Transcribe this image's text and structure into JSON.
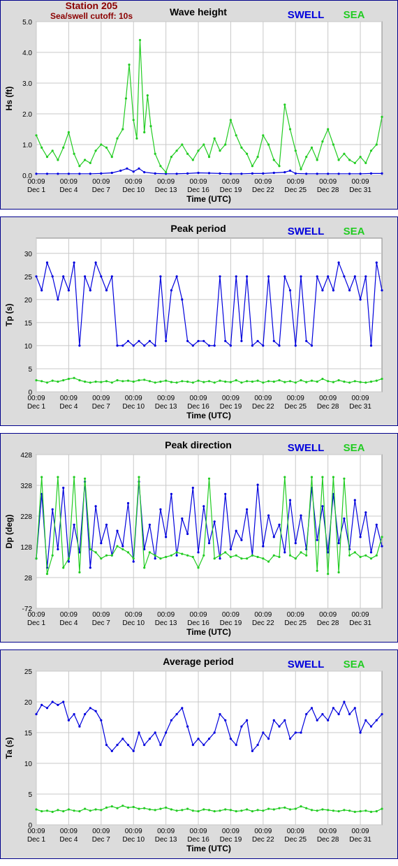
{
  "header": {
    "station": "Station 205",
    "cutoff": "Sea/swell cutoff: 10s"
  },
  "colors": {
    "swell": "#0000dd",
    "sea": "#22cc22",
    "frame": "#00008b",
    "panel_bg": "#dcdcdc",
    "station_text": "#8b0000"
  },
  "legend": {
    "swell": "SWELL",
    "sea": "SEA"
  },
  "x_axis": {
    "label": "Time (UTC)",
    "ticks": [
      {
        "t": "00:09",
        "d": "Dec 1",
        "day": 1
      },
      {
        "t": "00:09",
        "d": "Dec 4",
        "day": 4
      },
      {
        "t": "00:09",
        "d": "Dec 7",
        "day": 7
      },
      {
        "t": "00:09",
        "d": "Dec 10",
        "day": 10
      },
      {
        "t": "00:09",
        "d": "Dec 13",
        "day": 13
      },
      {
        "t": "00:09",
        "d": "Dec 16",
        "day": 16
      },
      {
        "t": "00:09",
        "d": "Dec 19",
        "day": 19
      },
      {
        "t": "00:09",
        "d": "Dec 22",
        "day": 22
      },
      {
        "t": "00:09",
        "d": "Dec 25",
        "day": 25
      },
      {
        "t": "00:09",
        "d": "Dec 28",
        "day": 28
      },
      {
        "t": "00:09",
        "d": "Dec 31",
        "day": 31
      }
    ],
    "xlim": [
      1,
      33
    ]
  },
  "chart_data": [
    {
      "type": "line",
      "title": "Wave height",
      "ylabel": "Hs (ft)",
      "xlabel": "Time (UTC)",
      "ylim": [
        0,
        5
      ],
      "yticks": [
        "0.0",
        "1.0",
        "2.0",
        "3.0",
        "4.0",
        "5.0"
      ],
      "grid": true,
      "series": [
        {
          "name": "SWELL",
          "x": [
            1,
            2,
            3,
            4,
            5,
            6,
            7,
            8,
            8.8,
            9.4,
            10,
            10.5,
            11,
            12,
            13,
            14,
            15,
            16,
            17,
            18,
            19,
            20,
            21,
            22,
            23,
            24,
            24.5,
            25,
            26,
            27,
            28,
            29,
            30,
            31,
            32,
            33
          ],
          "values": [
            0.05,
            0.05,
            0.05,
            0.05,
            0.05,
            0.05,
            0.06,
            0.08,
            0.15,
            0.22,
            0.12,
            0.22,
            0.1,
            0.06,
            0.05,
            0.05,
            0.06,
            0.08,
            0.07,
            0.06,
            0.05,
            0.05,
            0.06,
            0.06,
            0.08,
            0.1,
            0.15,
            0.06,
            0.05,
            0.05,
            0.05,
            0.05,
            0.05,
            0.05,
            0.06,
            0.06
          ]
        },
        {
          "name": "SEA",
          "x": [
            1,
            1.5,
            2,
            2.5,
            3,
            3.5,
            4,
            4.5,
            5,
            5.5,
            6,
            6.5,
            7,
            7.5,
            8,
            8.5,
            9,
            9.3,
            9.6,
            10,
            10.3,
            10.6,
            11,
            11.3,
            11.6,
            12,
            12.5,
            13,
            13.5,
            14,
            14.5,
            15,
            15.5,
            16,
            16.5,
            17,
            17.5,
            18,
            18.5,
            19,
            19.5,
            20,
            20.5,
            21,
            21.5,
            22,
            22.5,
            23,
            23.5,
            24,
            24.5,
            25,
            25.5,
            26,
            26.5,
            27,
            27.5,
            28,
            28.5,
            29,
            29.5,
            30,
            30.5,
            31,
            31.5,
            32,
            32.5,
            33
          ],
          "values": [
            1.3,
            0.9,
            0.6,
            0.8,
            0.5,
            0.9,
            1.4,
            0.7,
            0.3,
            0.5,
            0.4,
            0.8,
            1.0,
            0.9,
            0.6,
            1.2,
            1.5,
            2.5,
            3.6,
            1.8,
            1.2,
            4.4,
            1.4,
            2.6,
            1.6,
            0.7,
            0.3,
            0.1,
            0.6,
            0.8,
            1.0,
            0.7,
            0.5,
            0.8,
            1.0,
            0.6,
            1.2,
            0.8,
            1.0,
            1.8,
            1.3,
            0.9,
            0.7,
            0.3,
            0.6,
            1.3,
            1.0,
            0.5,
            0.3,
            2.3,
            1.5,
            0.8,
            0.2,
            0.6,
            0.9,
            0.5,
            1.1,
            1.5,
            1.0,
            0.5,
            0.7,
            0.5,
            0.4,
            0.6,
            0.4,
            0.8,
            1.0,
            1.9
          ]
        }
      ]
    },
    {
      "type": "line",
      "title": "Peak period",
      "ylabel": "Tp (s)",
      "xlabel": "Time (UTC)",
      "ylim": [
        0,
        33.3
      ],
      "yticks": [
        "0",
        "5",
        "10",
        "15",
        "20",
        "25",
        "30"
      ],
      "grid": true,
      "series": [
        {
          "name": "SWELL",
          "x": [
            1,
            1.5,
            2,
            2.5,
            3,
            3.5,
            4,
            4.5,
            5,
            5.5,
            6,
            6.5,
            7,
            7.5,
            8,
            8.5,
            9,
            9.5,
            10,
            10.5,
            11,
            11.5,
            12,
            12.5,
            13,
            13.5,
            14,
            14.5,
            15,
            15.5,
            16,
            16.5,
            17,
            17.5,
            18,
            18.5,
            19,
            19.5,
            20,
            20.5,
            21,
            21.5,
            22,
            22.5,
            23,
            23.5,
            24,
            24.5,
            25,
            25.5,
            26,
            26.5,
            27,
            27.5,
            28,
            28.5,
            29,
            29.5,
            30,
            30.5,
            31,
            31.5,
            32,
            32.5,
            33
          ],
          "values": [
            25,
            22,
            28,
            25,
            20,
            25,
            22,
            28,
            10,
            25,
            22,
            28,
            25,
            22,
            25,
            10,
            10,
            11,
            10,
            11,
            10,
            11,
            10,
            25,
            11,
            22,
            25,
            20,
            11,
            10,
            11,
            11,
            10,
            10,
            25,
            11,
            10,
            25,
            11,
            25,
            10,
            11,
            10,
            25,
            11,
            10,
            25,
            22,
            10,
            25,
            11,
            10,
            25,
            22,
            25,
            22,
            28,
            25,
            22,
            25,
            20,
            25,
            10,
            28,
            22
          ]
        },
        {
          "name": "SEA",
          "x": [
            1,
            1.5,
            2,
            2.5,
            3,
            3.5,
            4,
            4.5,
            5,
            5.5,
            6,
            6.5,
            7,
            7.5,
            8,
            8.5,
            9,
            9.5,
            10,
            10.5,
            11,
            11.5,
            12,
            12.5,
            13,
            13.5,
            14,
            14.5,
            15,
            15.5,
            16,
            16.5,
            17,
            17.5,
            18,
            18.5,
            19,
            19.5,
            20,
            20.5,
            21,
            21.5,
            22,
            22.5,
            23,
            23.5,
            24,
            24.5,
            25,
            25.5,
            26,
            26.5,
            27,
            27.5,
            28,
            28.5,
            29,
            29.5,
            30,
            30.5,
            31,
            31.5,
            32,
            32.5,
            33
          ],
          "values": [
            2.5,
            2.3,
            2.0,
            2.4,
            2.2,
            2.5,
            2.8,
            3.0,
            2.5,
            2.2,
            2.0,
            2.2,
            2.1,
            2.3,
            2.0,
            2.5,
            2.3,
            2.4,
            2.2,
            2.5,
            2.6,
            2.3,
            2.0,
            2.2,
            2.4,
            2.1,
            2.0,
            2.3,
            2.2,
            2.0,
            2.4,
            2.1,
            2.3,
            2.0,
            2.4,
            2.2,
            2.1,
            2.5,
            2.0,
            2.3,
            2.2,
            2.4,
            2.0,
            2.3,
            2.2,
            2.5,
            2.1,
            2.3,
            2.0,
            2.5,
            2.1,
            2.4,
            2.2,
            2.8,
            2.3,
            2.1,
            2.5,
            2.2,
            2.0,
            2.3,
            2.1,
            2.0,
            2.2,
            2.4,
            2.8
          ]
        }
      ]
    },
    {
      "type": "line",
      "title": "Peak direction",
      "ylabel": "Dp (deg)",
      "xlabel": "Time (UTC)",
      "ylim": [
        -72,
        428
      ],
      "yticks": [
        "-72",
        "28",
        "128",
        "228",
        "328",
        "428"
      ],
      "grid": true,
      "series": [
        {
          "name": "SWELL",
          "x": [
            1,
            1.5,
            2,
            2.5,
            3,
            3.5,
            4,
            4.5,
            5,
            5.5,
            6,
            6.5,
            7,
            7.5,
            8,
            8.5,
            9,
            9.5,
            10,
            10.5,
            11,
            11.5,
            12,
            12.5,
            13,
            13.5,
            14,
            14.5,
            15,
            15.5,
            16,
            16.5,
            17,
            17.5,
            18,
            18.5,
            19,
            19.5,
            20,
            20.5,
            21,
            21.5,
            22,
            22.5,
            23,
            23.5,
            24,
            24.5,
            25,
            25.5,
            26,
            26.5,
            27,
            27.5,
            28,
            28.5,
            29,
            29.5,
            30,
            30.5,
            31,
            31.5,
            32,
            32.5,
            33
          ],
          "values": [
            90,
            300,
            60,
            250,
            120,
            320,
            80,
            200,
            110,
            340,
            60,
            260,
            140,
            200,
            100,
            180,
            130,
            270,
            80,
            340,
            120,
            200,
            90,
            250,
            160,
            300,
            100,
            220,
            170,
            320,
            110,
            260,
            140,
            210,
            90,
            300,
            120,
            180,
            150,
            250,
            100,
            330,
            130,
            230,
            160,
            200,
            110,
            280,
            140,
            230,
            120,
            320,
            150,
            260,
            110,
            300,
            140,
            220,
            120,
            280,
            160,
            240,
            110,
            200,
            130
          ]
        },
        {
          "name": "SEA",
          "x": [
            1,
            1.5,
            2,
            2.5,
            3,
            3.5,
            4,
            4.5,
            5,
            5.5,
            6,
            6.5,
            7,
            7.5,
            8,
            8.5,
            9,
            9.5,
            10,
            10.5,
            11,
            11.5,
            12,
            12.5,
            13,
            13.5,
            14,
            14.5,
            15,
            15.5,
            16,
            16.5,
            17,
            17.5,
            18,
            18.5,
            19,
            19.5,
            20,
            20.5,
            21,
            21.5,
            22,
            22.5,
            23,
            23.5,
            24,
            24.5,
            25,
            25.5,
            26,
            26.5,
            27,
            27.5,
            28,
            28.5,
            29,
            29.5,
            30,
            30.5,
            31,
            31.5,
            32,
            32.5,
            33
          ],
          "values": [
            90,
            355,
            40,
            100,
            355,
            60,
            90,
            355,
            45,
            350,
            120,
            110,
            90,
            100,
            100,
            130,
            120,
            110,
            90,
            355,
            60,
            110,
            100,
            90,
            95,
            100,
            110,
            105,
            100,
            95,
            60,
            100,
            350,
            90,
            100,
            110,
            95,
            100,
            90,
            90,
            100,
            95,
            90,
            80,
            100,
            95,
            355,
            100,
            90,
            110,
            100,
            355,
            50,
            355,
            40,
            355,
            45,
            350,
            100,
            110,
            95,
            100,
            90,
            100,
            160
          ]
        }
      ]
    },
    {
      "type": "line",
      "title": "Average period",
      "ylabel": "Ta (s)",
      "xlabel": "Time (UTC)",
      "ylim": [
        0,
        25
      ],
      "yticks": [
        "0",
        "5",
        "10",
        "15",
        "20",
        "25"
      ],
      "grid": true,
      "series": [
        {
          "name": "SWELL",
          "x": [
            1,
            1.5,
            2,
            2.5,
            3,
            3.5,
            4,
            4.5,
            5,
            5.5,
            6,
            6.5,
            7,
            7.5,
            8,
            8.5,
            9,
            9.5,
            10,
            10.5,
            11,
            11.5,
            12,
            12.5,
            13,
            13.5,
            14,
            14.5,
            15,
            15.5,
            16,
            16.5,
            17,
            17.5,
            18,
            18.5,
            19,
            19.5,
            20,
            20.5,
            21,
            21.5,
            22,
            22.5,
            23,
            23.5,
            24,
            24.5,
            25,
            25.5,
            26,
            26.5,
            27,
            27.5,
            28,
            28.5,
            29,
            29.5,
            30,
            30.5,
            31,
            31.5,
            32,
            32.5,
            33
          ],
          "values": [
            18,
            19.5,
            19,
            20,
            19.5,
            20,
            17,
            18,
            16,
            18,
            19,
            18.5,
            17,
            13,
            12,
            13,
            14,
            13,
            12,
            15,
            13,
            14,
            15,
            13,
            15,
            17,
            18,
            19,
            16,
            13,
            14,
            13,
            14,
            15,
            18,
            17,
            14,
            13,
            16,
            17,
            12,
            13,
            15,
            14,
            17,
            16,
            17,
            14,
            15,
            15,
            18,
            19,
            17,
            18,
            17,
            19,
            18,
            20,
            18,
            19,
            15,
            17,
            16,
            17,
            18
          ]
        },
        {
          "name": "SEA",
          "x": [
            1,
            1.5,
            2,
            2.5,
            3,
            3.5,
            4,
            4.5,
            5,
            5.5,
            6,
            6.5,
            7,
            7.5,
            8,
            8.5,
            9,
            9.5,
            10,
            10.5,
            11,
            11.5,
            12,
            12.5,
            13,
            13.5,
            14,
            14.5,
            15,
            15.5,
            16,
            16.5,
            17,
            17.5,
            18,
            18.5,
            19,
            19.5,
            20,
            20.5,
            21,
            21.5,
            22,
            22.5,
            23,
            23.5,
            24,
            24.5,
            25,
            25.5,
            26,
            26.5,
            27,
            27.5,
            28,
            28.5,
            29,
            29.5,
            30,
            30.5,
            31,
            31.5,
            32,
            32.5,
            33
          ],
          "values": [
            2.5,
            2.2,
            2.3,
            2.1,
            2.4,
            2.2,
            2.5,
            2.3,
            2.2,
            2.6,
            2.3,
            2.5,
            2.4,
            2.8,
            3.0,
            2.7,
            3.1,
            2.8,
            2.9,
            2.6,
            2.7,
            2.5,
            2.4,
            2.6,
            2.8,
            2.5,
            2.3,
            2.4,
            2.6,
            2.3,
            2.2,
            2.5,
            2.4,
            2.2,
            2.3,
            2.5,
            2.4,
            2.2,
            2.3,
            2.5,
            2.2,
            2.4,
            2.3,
            2.6,
            2.5,
            2.7,
            2.8,
            2.5,
            2.6,
            3.0,
            2.7,
            2.4,
            2.3,
            2.5,
            2.4,
            2.3,
            2.2,
            2.4,
            2.3,
            2.1,
            2.2,
            2.3,
            2.1,
            2.2,
            2.6
          ]
        }
      ]
    }
  ]
}
